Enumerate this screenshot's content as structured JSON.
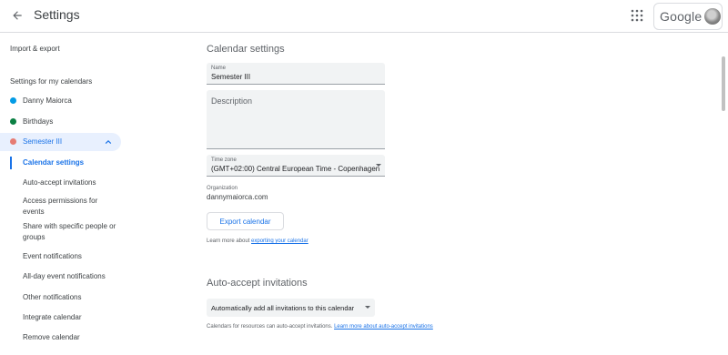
{
  "header": {
    "title": "Settings",
    "back_icon": "arrow-back-icon",
    "apps_icon": "apps-grid-icon",
    "brand": "Google"
  },
  "sidebar": {
    "import_export": "Import & export",
    "section_title": "Settings for my calendars",
    "calendars": [
      {
        "name": "Danny Maiorca",
        "color": "#039be5"
      },
      {
        "name": "Birthdays",
        "color": "#0b8043"
      },
      {
        "name": "Semester III",
        "color": "#e67c73",
        "active": true
      }
    ],
    "sub_items": [
      {
        "label": "Calendar settings",
        "selected": true
      },
      {
        "label": "Auto-accept invitations"
      },
      {
        "label": "Access permissions for events"
      },
      {
        "label": "Share with specific people or groups"
      },
      {
        "label": "Event notifications"
      },
      {
        "label": "All-day event notifications"
      },
      {
        "label": "Other notifications"
      },
      {
        "label": "Integrate calendar"
      },
      {
        "label": "Remove calendar"
      }
    ]
  },
  "main": {
    "calendar_settings": {
      "title": "Calendar settings",
      "name_label": "Name",
      "name_value": "Semester III",
      "description_placeholder": "Description",
      "timezone_label": "Time zone",
      "timezone_value": "(GMT+02:00) Central European Time - Copenhagen",
      "organization_label": "Organization",
      "organization_value": "dannymaiorca.com",
      "export_button": "Export calendar",
      "learn_more_prefix": "Learn more about",
      "learn_more_link": "exporting your calendar"
    },
    "auto_accept": {
      "title": "Auto-accept invitations",
      "select_value": "Automatically add all invitations to this calendar",
      "help_prefix": "Calendars for resources can auto-accept invitations.",
      "help_link": "Learn more about auto-accept invitations"
    }
  },
  "colors": {
    "accent": "#1a73e8",
    "active_bg": "#e8f0fe",
    "field_bg": "#f1f3f4"
  }
}
